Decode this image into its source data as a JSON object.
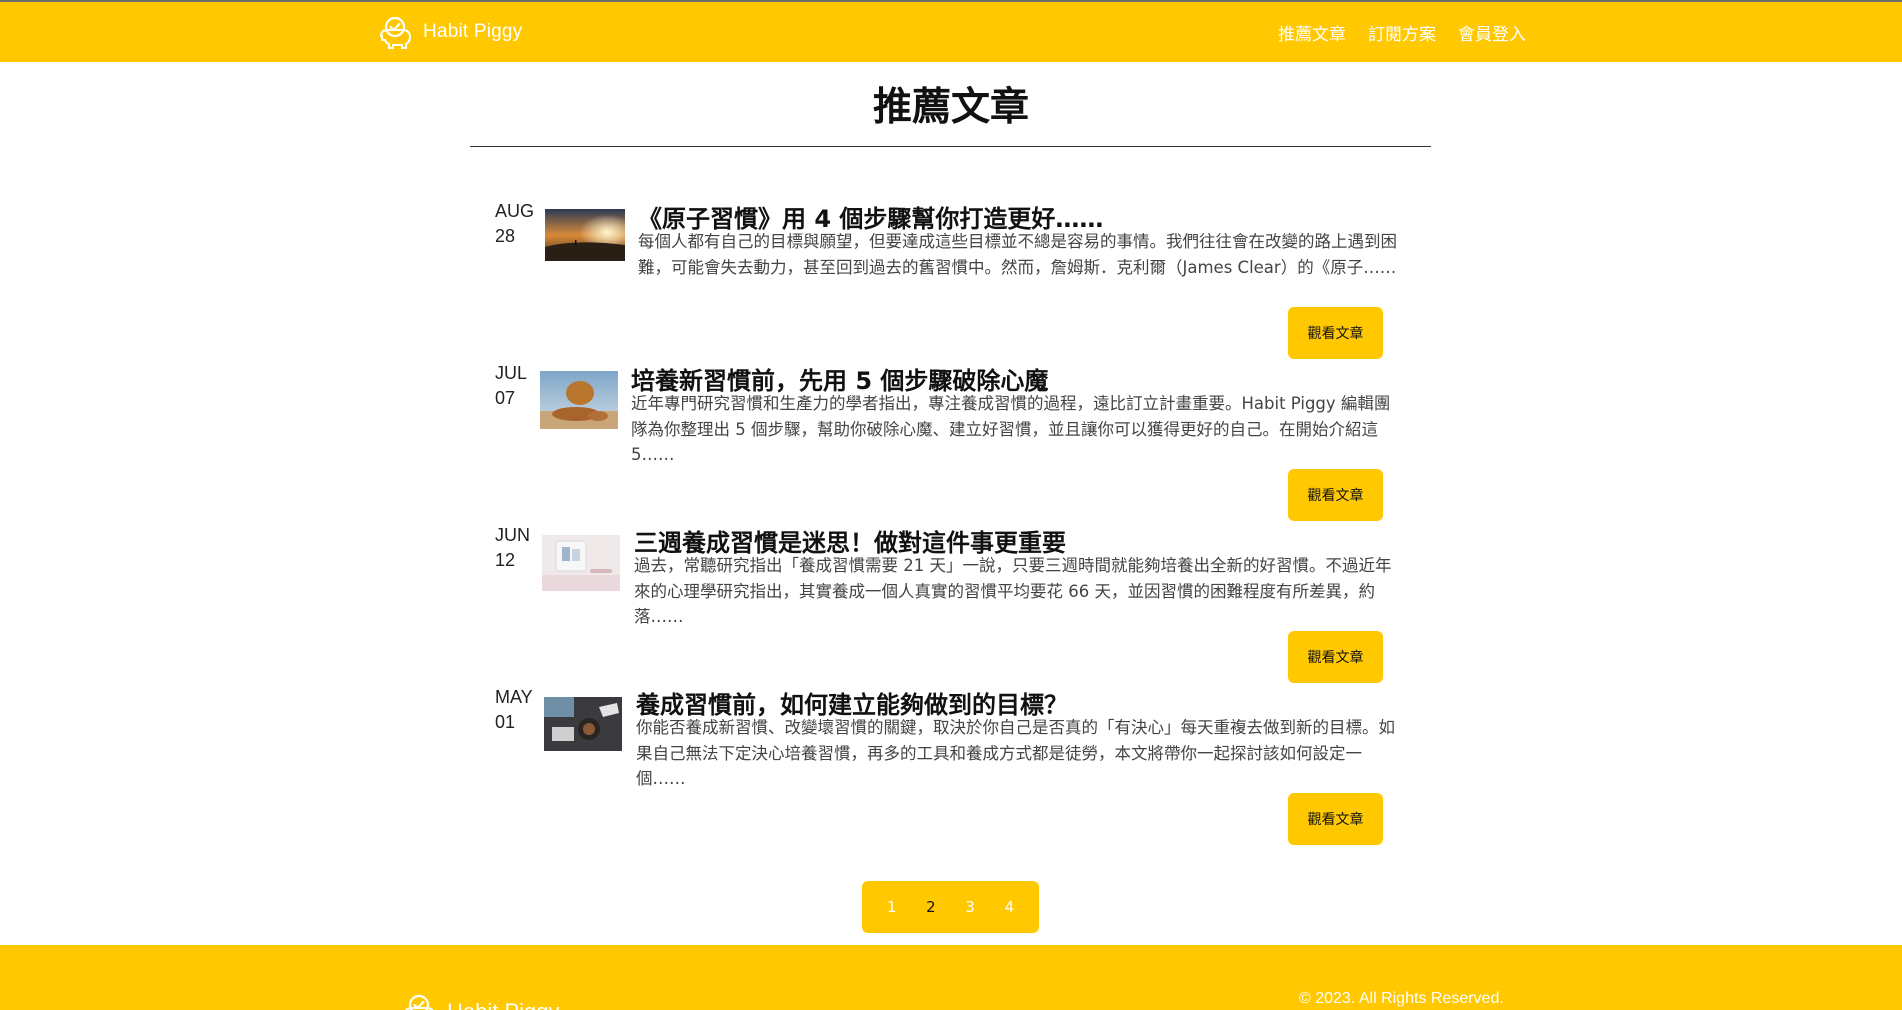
{
  "header": {
    "brand": "Habit Piggy",
    "brand_icon": "piggy-icon",
    "nav": [
      "推薦文章",
      "訂閱方案",
      "會員登入"
    ]
  },
  "main": {
    "page_title": "推薦文章",
    "read_button_label": "觀看文章",
    "articles": [
      {
        "month": "AUG",
        "day": "28",
        "title": "《原子習慣》用 4 個步驟幫你打造更好……",
        "excerpt": "每個人都有自己的目標與願望，但要達成這些目標並不總是容易的事情。我們往往會在改變的路上遇到困難，可能會失去動力，甚至回到過去的舊習慣中。然而，詹姆斯．克利爾（James Clear）的《原子……"
      },
      {
        "month": "JUL",
        "day": "07",
        "title": "培養新習慣前，先用 5 個步驟破除心魔",
        "excerpt": "近年專門研究習慣和生產力的學者指出，專注養成習慣的過程，遠比訂立計畫重要。Habit Piggy 編輯團隊為你整理出 5 個步驟，幫助你破除心魔、建立好習慣，並且讓你可以獲得更好的自己。在開始介紹這 5……"
      },
      {
        "month": "JUN",
        "day": "12",
        "title": "三週養成習慣是迷思！做對這件事更重要",
        "excerpt": "過去，常聽研究指出「養成習慣需要 21 天」一說，只要三週時間就能夠培養出全新的好習慣。不過近年來的心理學研究指出，其實養成一個人真實的習慣平均要花 66 天，並因習慣的困難程度有所差異，約落……"
      },
      {
        "month": "MAY",
        "day": "01",
        "title": "養成習慣前，如何建立能夠做到的目標？",
        "excerpt": "你能否養成新習慣、改變壞習慣的關鍵，取決於你自己是否真的「有決心」每天重複去做到新的目標。如果自己無法下定決心培養習慣，再多的工具和養成方式都是徒勞，本文將帶你一起探討該如何設定一個……"
      }
    ]
  },
  "pagination": {
    "pages": [
      "1",
      "2",
      "3",
      "4"
    ],
    "current": "2"
  },
  "footer": {
    "brand": "Habit Piggy",
    "copyright": "© 2023. All Rights Reserved."
  },
  "colors": {
    "accent": "#ffc800",
    "text": "#222222",
    "white": "#ffffff"
  }
}
